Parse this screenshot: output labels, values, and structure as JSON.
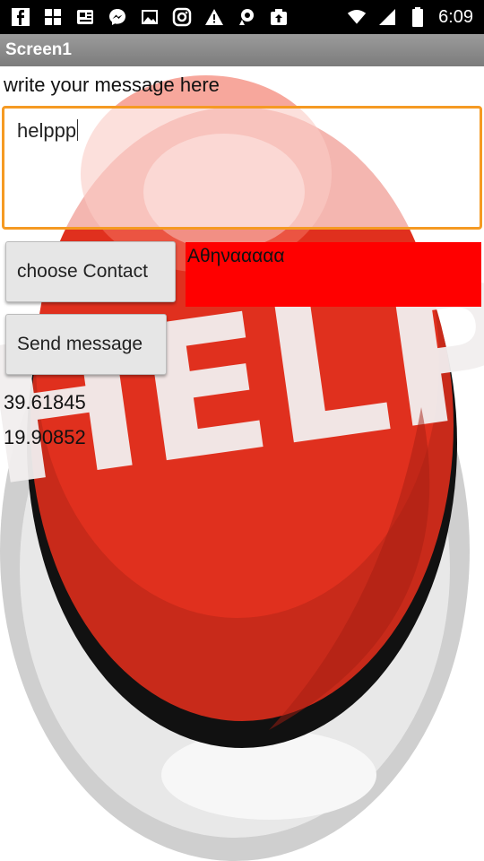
{
  "status_bar": {
    "time": "6:09",
    "left_icons": [
      "facebook-icon",
      "gallery-icon",
      "news-icon",
      "messenger-icon",
      "image-icon",
      "instagram-icon",
      "warning-icon",
      "maps-icon",
      "upload-icon"
    ],
    "right_icons": [
      "wifi-icon",
      "signal-icon",
      "battery-icon"
    ]
  },
  "title_bar": {
    "title": "Screen1"
  },
  "form": {
    "prompt_label": "write your message here",
    "message_value": "helppp",
    "choose_contact_label": "choose Contact",
    "selected_contact": "Αθηνααααα",
    "send_label": "Send message",
    "latitude": "39.61845",
    "longitude": "19.90852"
  },
  "background": {
    "image_text": "HELP"
  },
  "colors": {
    "contact_bg": "#ff0000",
    "field_border": "#f59a23",
    "button_red": "#e0301e"
  }
}
